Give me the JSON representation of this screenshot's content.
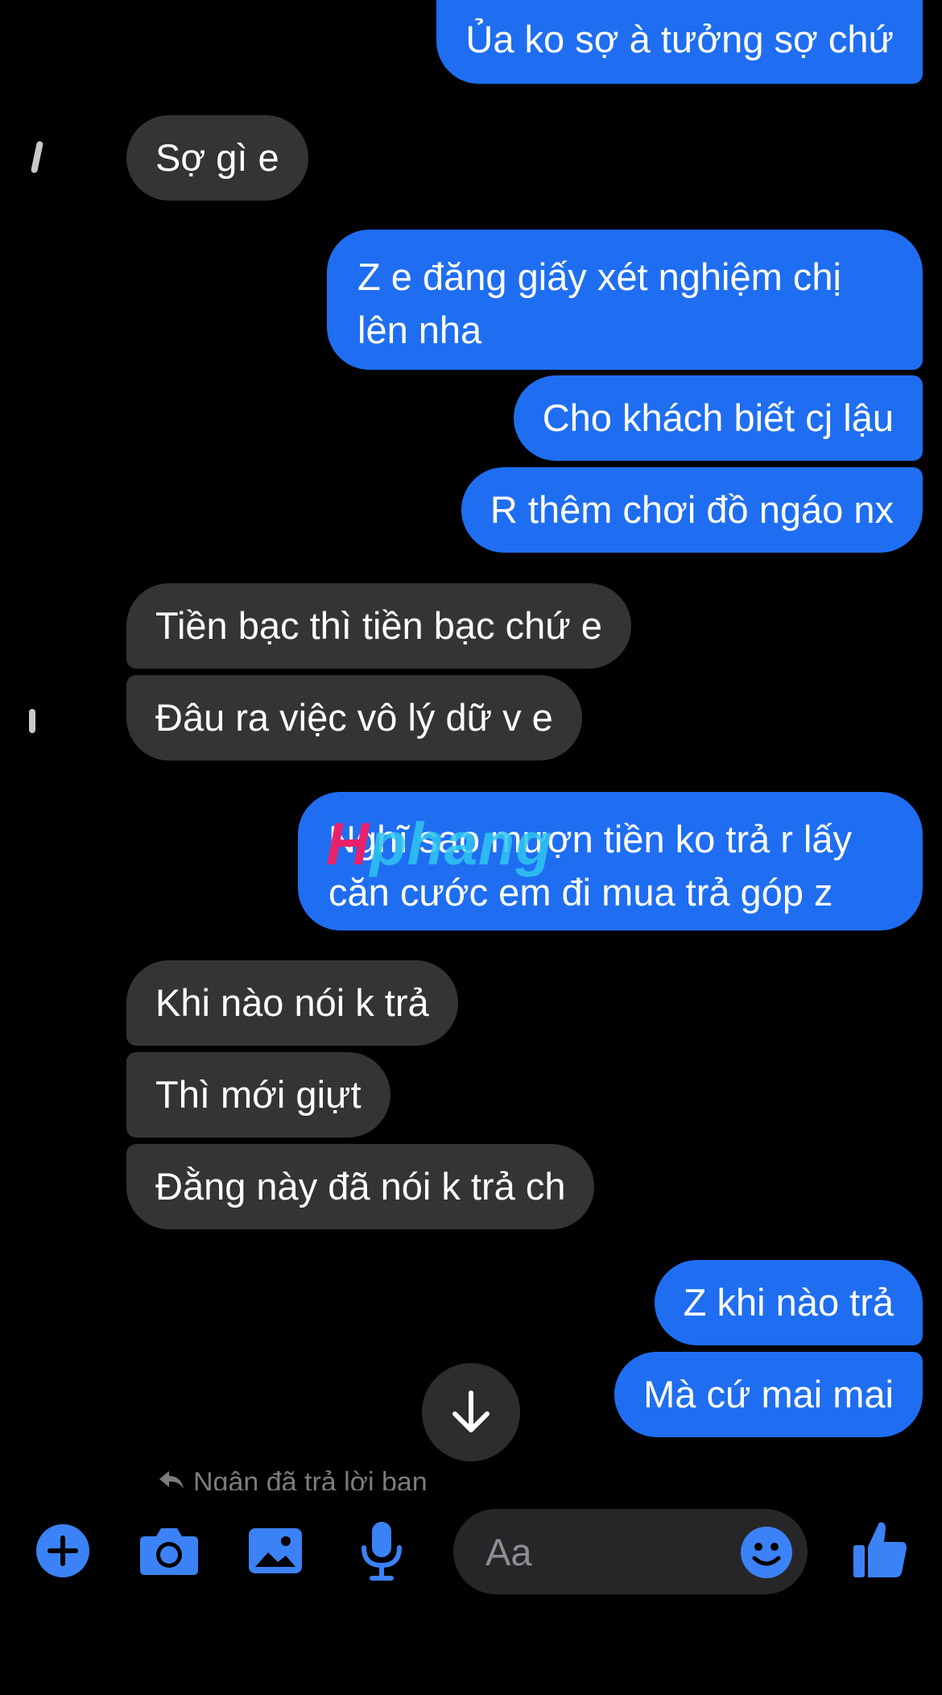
{
  "colors": {
    "outgoing_bubble": "#1f6ef2",
    "incoming_bubble": "#333436",
    "accent": "#3b82f6",
    "background": "#000000"
  },
  "messages": [
    {
      "direction": "outgoing",
      "text": "Ủa ko sợ à tưởng sợ chứ"
    },
    {
      "direction": "incoming",
      "text": "Sợ gì e"
    },
    {
      "direction": "outgoing",
      "text": "Z e đăng giấy xét nghiệm chị lên nha"
    },
    {
      "direction": "outgoing",
      "text": "Cho khách biết cj lậu"
    },
    {
      "direction": "outgoing",
      "text": "R thêm chơi đồ ngáo nx"
    },
    {
      "direction": "incoming",
      "text": "Tiền bạc thì tiền bạc chứ e"
    },
    {
      "direction": "incoming",
      "text": "Đâu ra việc vô lý dữ v e"
    },
    {
      "direction": "outgoing",
      "text": "Nghĩ sao mượn tiền ko trả r lấy căn cước em đi mua trả góp z"
    },
    {
      "direction": "incoming",
      "text": "Khi nào nói k trả"
    },
    {
      "direction": "incoming",
      "text": "Thì mới giựt"
    },
    {
      "direction": "incoming",
      "text": "Đằng này đã nói k trả ch"
    },
    {
      "direction": "outgoing",
      "text": "Z khi nào trả"
    },
    {
      "direction": "outgoing",
      "text": "Mà cứ mai mai"
    }
  ],
  "watermark": {
    "first": "H",
    "rest": "phang"
  },
  "reply_note": "Ngân đã trả lời bạn",
  "composer": {
    "placeholder": "Aa",
    "icons": [
      "plus-icon",
      "camera-icon",
      "image-icon",
      "microphone-icon",
      "emoji-icon",
      "thumbs-up-icon",
      "arrow-down-icon"
    ]
  }
}
